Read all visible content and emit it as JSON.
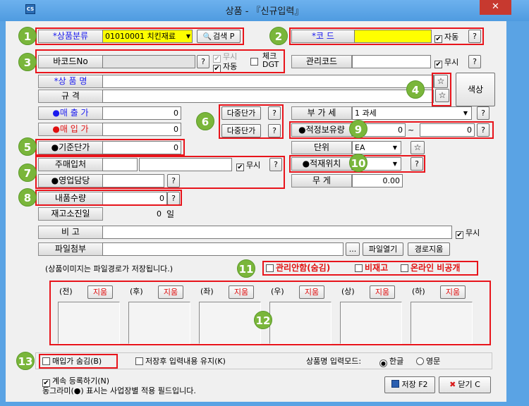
{
  "window": {
    "title": "상품 - 『신규입력』",
    "app_icon": "CS",
    "close": "✕"
  },
  "fields": {
    "category_label": "*상품분류",
    "category_value": "01010001 치킨재료",
    "search_button": "검색 P",
    "code_label": "*코 드",
    "code_value": "",
    "auto_label": "자동",
    "help": "?",
    "barcode_label": "바코드No",
    "barcode_value": "",
    "ignore_label": "무시",
    "auto2_label": "자동",
    "check_label_1": "체크",
    "check_label_2": "DGT",
    "mgmt_code_label": "관리코드",
    "mgmt_code_value": "",
    "mgmt_ignore_label": "무시",
    "name_label": "*상 품 명",
    "name_value": "",
    "star": "☆",
    "color_button": "색상",
    "spec_label": "규 격",
    "spec_value": "",
    "sale_price_label": "●매 출 가",
    "sale_price_value": "0",
    "multi_price_button": "다중단가",
    "purchase_price_label": "●매 입 가",
    "purchase_price_value": "0",
    "vat_label": "부 가 세",
    "vat_value": "1 과세",
    "proper_stock_label": "●적정보유량",
    "proper_stock_from": "0",
    "tilde": "~",
    "proper_stock_to": "0",
    "base_price_label": "●기준단가",
    "base_price_value": "0",
    "unit_label": "단위",
    "unit_value": "EA",
    "main_supplier_label": "주매입처",
    "main_supplier_code": "",
    "main_supplier_name": "",
    "supplier_ignore_label": "무시",
    "stock_location_label": "●적재위치",
    "stock_location_value": "",
    "sales_rep_label": "●영업담당",
    "sales_rep_value": "",
    "weight_label": "무 게",
    "weight_value": "0.00",
    "delivery_qty_label": "내품수량",
    "delivery_qty_value": "0",
    "stock_days_label": "재고소진일",
    "stock_days_value": "0",
    "stock_days_unit": "일",
    "remarks_label": "비 고",
    "remarks_value": "",
    "remarks_ignore_label": "무시",
    "attach_label": "파일첨부",
    "attach_value": "",
    "browse_button": "...",
    "open_file_button": "파일열기",
    "clear_path_button": "경로지움"
  },
  "image_note": "(상품이미지는 파일경로가 저장됩니다.)",
  "flags": {
    "hidden": "관리안함(숨김)",
    "no_stock": "비재고",
    "online_private": "온라인 비공개"
  },
  "images": [
    {
      "label": "(전)",
      "delete": "지움"
    },
    {
      "label": "(후)",
      "delete": "지움"
    },
    {
      "label": "(좌)",
      "delete": "지움"
    },
    {
      "label": "(우)",
      "delete": "지움"
    },
    {
      "label": "(상)",
      "delete": "지움"
    },
    {
      "label": "(하)",
      "delete": "지움"
    }
  ],
  "options": {
    "hide_purchase": "매입가 숨김(B)",
    "keep_input": "저장후 입력내용 유지(K)",
    "input_mode_label": "상품명 입력모드:",
    "korean": "한글",
    "english": "영문"
  },
  "footer": {
    "continue_label": "계속 등록하기(N)",
    "note": "동그라미(●) 표시는 사업장별 적용 필드입니다.",
    "save_button": "저장 F2",
    "close_button": "닫기 C"
  },
  "badges": [
    "1",
    "2",
    "3",
    "4",
    "5",
    "6",
    "7",
    "8",
    "9",
    "10",
    "11",
    "12",
    "13"
  ],
  "colors": {
    "highlight": "#e8141b",
    "badge": "#7ab63b",
    "title_bar": "#5aa3e4"
  }
}
